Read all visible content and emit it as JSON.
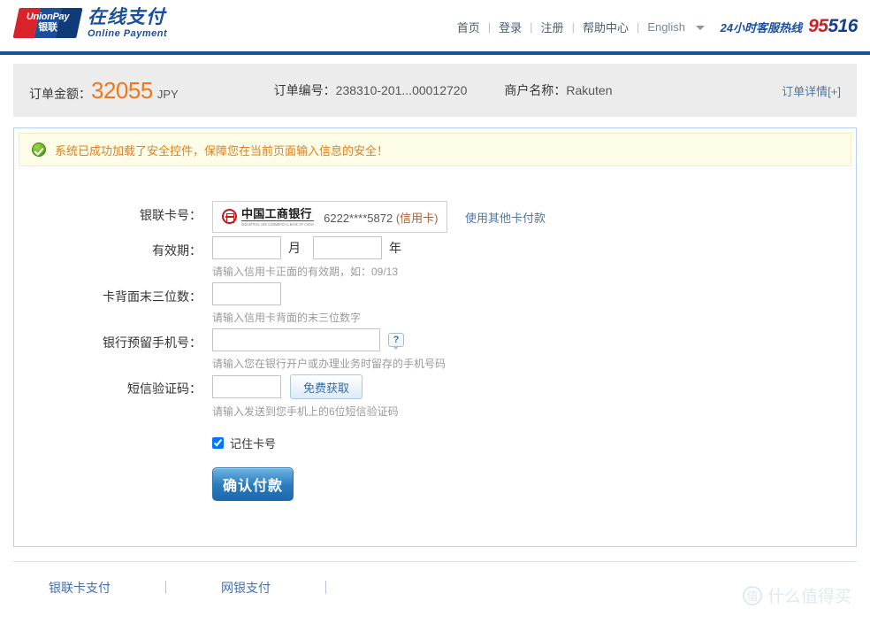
{
  "header": {
    "logo": {
      "brand_line1": "UnionPay",
      "brand_line2": "银联",
      "title_cn": "在线支付",
      "title_en": "Online Payment"
    },
    "nav": [
      {
        "label": "首页"
      },
      {
        "label": "登录"
      },
      {
        "label": "注册"
      },
      {
        "label": "帮助中心"
      }
    ],
    "separator": "|",
    "language": "English",
    "hotline_label": "24小时客服热线",
    "hotline_number_red": "95",
    "hotline_number_blue": "516"
  },
  "order": {
    "amount_label": "订单金额：",
    "amount_value": "32055",
    "currency": "JPY",
    "number_label": "订单编号：",
    "number_value": "238310-201...00012720",
    "merchant_label": "商户名称：",
    "merchant_value": "Rakuten",
    "detail_link": "订单详情[+]"
  },
  "alert": {
    "icon": "success-check-icon",
    "message": "系统已成功加载了安全控件，保障您在当前页面输入信息的安全！"
  },
  "form": {
    "card": {
      "label": "银联卡号：",
      "bank_name": "中国工商银行",
      "bank_name_en": "INDUSTRIAL AND COMMERCIAL BANK OF CHINA",
      "masked_number": "6222****5872",
      "card_type": "(信用卡)",
      "other_card_link": "使用其他卡付款"
    },
    "expiry": {
      "label": "有效期：",
      "month_value": "",
      "month_unit": "月",
      "year_value": "",
      "year_unit": "年",
      "hint": "请输入信用卡正面的有效期，如：09/13"
    },
    "cvv": {
      "label": "卡背面末三位数：",
      "value": "",
      "hint": "请输入信用卡背面的末三位数字"
    },
    "phone": {
      "label": "银行预留手机号：",
      "value": "",
      "help_icon": "question-mark-icon",
      "hint": "请输入您在银行开户或办理业务时留存的手机号码"
    },
    "sms": {
      "label": "短信验证码：",
      "value": "",
      "get_code_button": "免费获取",
      "hint": "请输入发送到您手机上的6位短信验证码"
    },
    "remember": {
      "label": "记住卡号",
      "checked": true
    },
    "submit_label": "确认付款"
  },
  "footer": {
    "links": [
      {
        "label": "银联卡支付"
      },
      {
        "label": "网银支付"
      }
    ],
    "watermark_mark": "值",
    "watermark_text": "什么值得买"
  },
  "colors": {
    "brand_blue": "#1b4f9c",
    "amount_orange": "#f07818",
    "alert_text": "#e08020",
    "link_blue": "#4a77a8",
    "hotline_red": "#cf2027",
    "icbc_red": "#c8161d"
  }
}
